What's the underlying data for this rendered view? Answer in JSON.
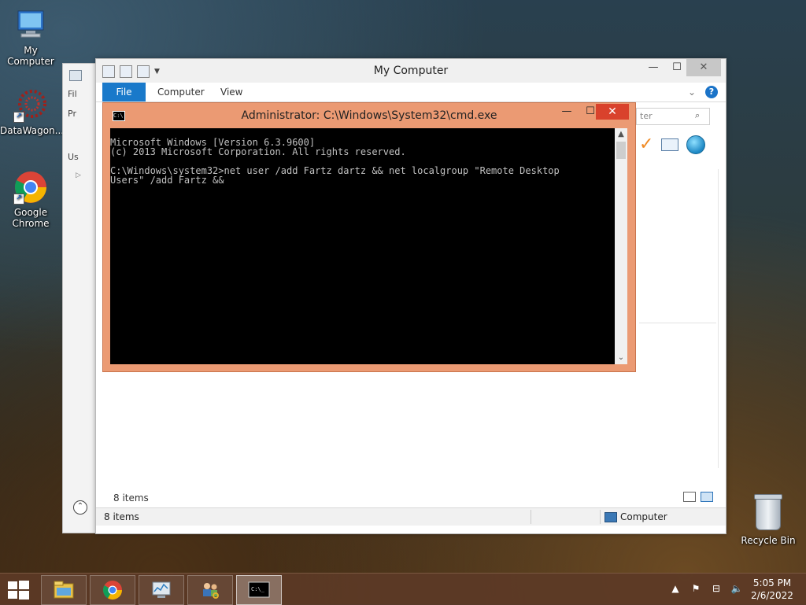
{
  "desktop": {
    "icons": [
      {
        "label": "My Computer",
        "icon": "my-computer-icon"
      },
      {
        "label": "DataWagon...",
        "icon": "datawagon-icon"
      },
      {
        "label": "Google Chrome",
        "icon": "chrome-icon"
      }
    ],
    "recycle_bin": {
      "label": "Recycle Bin",
      "icon": "recycle-bin-icon"
    }
  },
  "back_window": {
    "fragments": [
      "Fil",
      "Pr",
      "Us"
    ]
  },
  "explorer": {
    "title": "My Computer",
    "tabs": [
      "File",
      "Computer",
      "View"
    ],
    "search_placeholder": "ter",
    "items_count_inner": "8 items",
    "status_items": "8 items",
    "status_location": "Computer",
    "help_label": "?"
  },
  "cmd": {
    "title": "Administrator: C:\\Windows\\System32\\cmd.exe",
    "lines": [
      "Microsoft Windows [Version 6.3.9600]",
      "(c) 2013 Microsoft Corporation. All rights reserved.",
      "",
      "C:\\Windows\\system32>net user /add Fartz dartz && net localgroup \"Remote Desktop",
      "Users\" /add Fartz &&"
    ]
  },
  "taskbar": {
    "apps": [
      "file-explorer-icon",
      "chrome-icon",
      "performance-monitor-icon",
      "users-keys-icon",
      "cmd-icon"
    ],
    "active_app": "cmd-icon",
    "time": "5:05 PM",
    "date": "2/6/2022"
  },
  "colors": {
    "accent": "#1979ca",
    "cmd_frame": "#eb9a73",
    "cmd_close": "#d9422c",
    "taskbar": "#5c3a26"
  }
}
